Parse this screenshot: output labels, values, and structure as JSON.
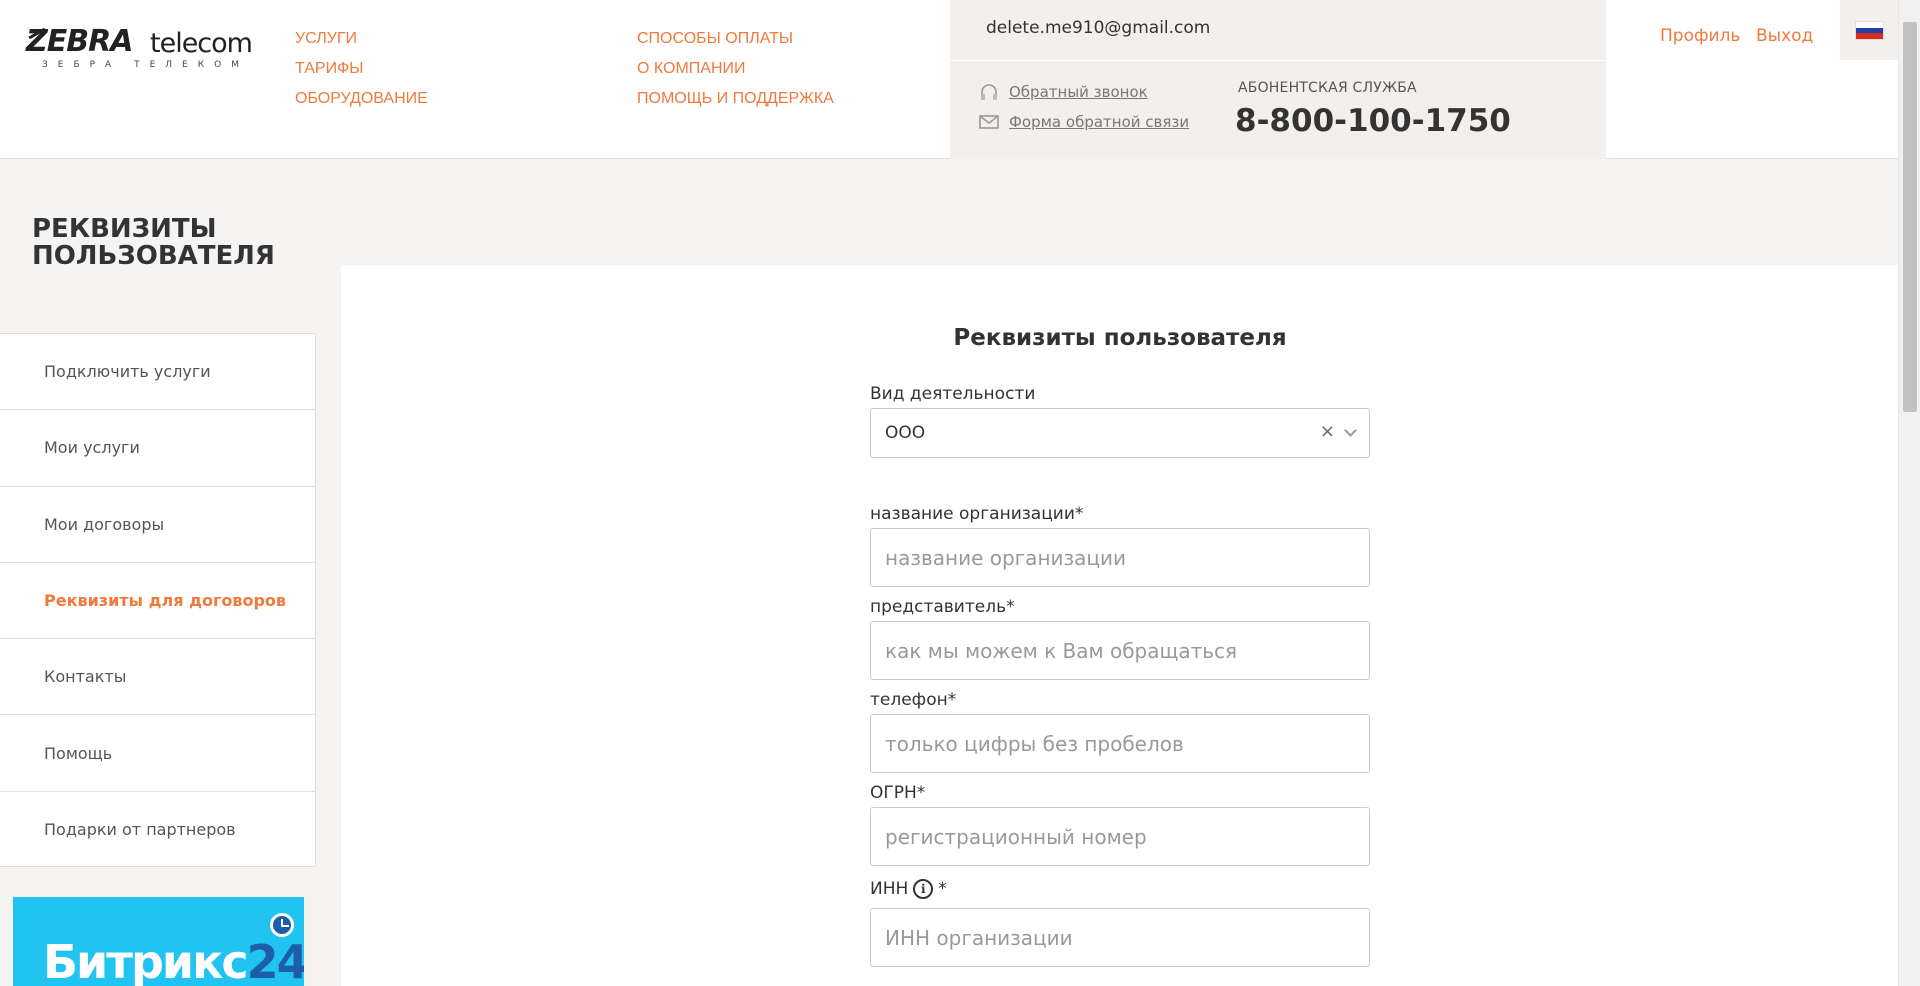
{
  "header": {
    "logo": {
      "brand_a": "ZEBRA",
      "brand_b": "telecom",
      "sub": "ЗЕБРА ТЕЛЕКОМ"
    },
    "nav_col1": [
      "УСЛУГИ",
      "ТАРИФЫ",
      "ОБОРУДОВАНИЕ"
    ],
    "nav_col2": [
      "СПОСОБЫ ОПЛАТЫ",
      "О КОМПАНИИ",
      "ПОМОЩЬ И ПОДДЕРЖКА"
    ],
    "user_email": "delete.me910@gmail.com",
    "callback": "Обратный звонок",
    "feedback": "Форма обратной связи",
    "service_label": "АБОНЕНТСКАЯ СЛУЖБА",
    "service_phone": "8-800-100-1750",
    "profile": "Профиль",
    "logout": "Выход",
    "flag_colors": [
      "#ffffff",
      "#1f3fa5",
      "#d52b1e"
    ]
  },
  "page": {
    "title_line1": "РЕКВИЗИТЫ",
    "title_line2": "ПОЛЬЗОВАТЕЛЯ"
  },
  "sidebar": {
    "items": [
      {
        "label": "Подключить услуги",
        "active": false
      },
      {
        "label": "Мои услуги",
        "active": false
      },
      {
        "label": "Мои договоры",
        "active": false
      },
      {
        "label": "Реквизиты для договоров",
        "active": true
      },
      {
        "label": "Контакты",
        "active": false
      },
      {
        "label": "Помощь",
        "active": false
      },
      {
        "label": "Подарки от партнеров",
        "active": false
      }
    ]
  },
  "banner": {
    "text": "Битрикс",
    "num": "24"
  },
  "form": {
    "title": "Реквизиты пользователя",
    "activity_label": "Вид деятельности",
    "activity_value": "ООО",
    "clear_glyph": "×",
    "org_label": "название организации*",
    "org_placeholder": "название организации",
    "rep_label": "представитель*",
    "rep_placeholder": "как мы можем к Вам обращаться",
    "phone_label": "телефон*",
    "phone_placeholder": "только цифры без пробелов",
    "ogrn_label": "ОГРН*",
    "ogrn_placeholder": "регистрационный номер",
    "inn_label": "ИНН",
    "inn_star": "*",
    "inn_placeholder": "ИНН организации"
  },
  "colors": {
    "accent": "#f07a3c",
    "bitrix_blue": "#21c3f0"
  }
}
